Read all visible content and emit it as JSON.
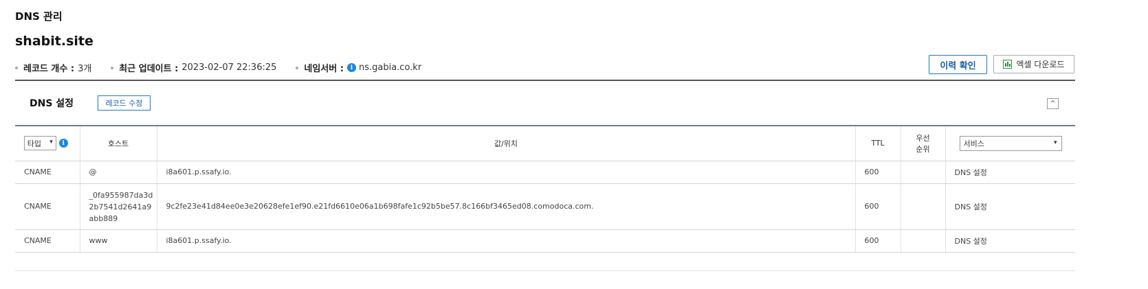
{
  "page": {
    "title": "DNS 관리",
    "domain": "shabit.site"
  },
  "meta": {
    "record_count_label": "레코드 개수 :",
    "record_count_value": "3개",
    "updated_label": "최근 업데이트 :",
    "updated_value": "2023-02-07 22:36:25",
    "nameserver_label": "네임서버 :",
    "nameserver_value": "ns.gabia.co.kr",
    "info_glyph": "i"
  },
  "actions": {
    "history_label": "이력 확인",
    "excel_label": "엑셀 다운로드"
  },
  "section": {
    "title": "DNS 설정",
    "edit_label": "레코드 수정",
    "collapse_glyph": "^"
  },
  "table": {
    "headers": {
      "type_select": "타입",
      "host": "호스트",
      "value": "값/위치",
      "ttl": "TTL",
      "priority_line1": "우선",
      "priority_line2": "순위",
      "service_select": "서비스"
    },
    "rows": [
      {
        "type": "CNAME",
        "host_lines": [
          "@"
        ],
        "value": "i8a601.p.ssafy.io.",
        "ttl": "600",
        "priority": "",
        "service": "DNS 설정"
      },
      {
        "type": "CNAME",
        "host_lines": [
          "_0fa955987da3d",
          "2b7541d2641a9",
          "abb889"
        ],
        "value": "9c2fe23e41d84ee0e3e20628efe1ef90.e21fd6610e06a1b698fafe1c92b5be57.8c166bf3465ed08.comodoca.com.",
        "ttl": "600",
        "priority": "",
        "service": "DNS 설정"
      },
      {
        "type": "CNAME",
        "host_lines": [
          "www"
        ],
        "value": "i8a601.p.ssafy.io.",
        "ttl": "600",
        "priority": "",
        "service": "DNS 설정"
      }
    ]
  },
  "icons": {
    "info": "info-circle-icon",
    "excel": "bar-chart-icon",
    "dropdown": "chevron-down-icon",
    "collapse": "chevron-up-icon"
  },
  "colors": {
    "accent": "#1a78c2",
    "info": "#1a88d8",
    "excel": "#2f8a3b",
    "header_rule": "#6d7a86"
  }
}
